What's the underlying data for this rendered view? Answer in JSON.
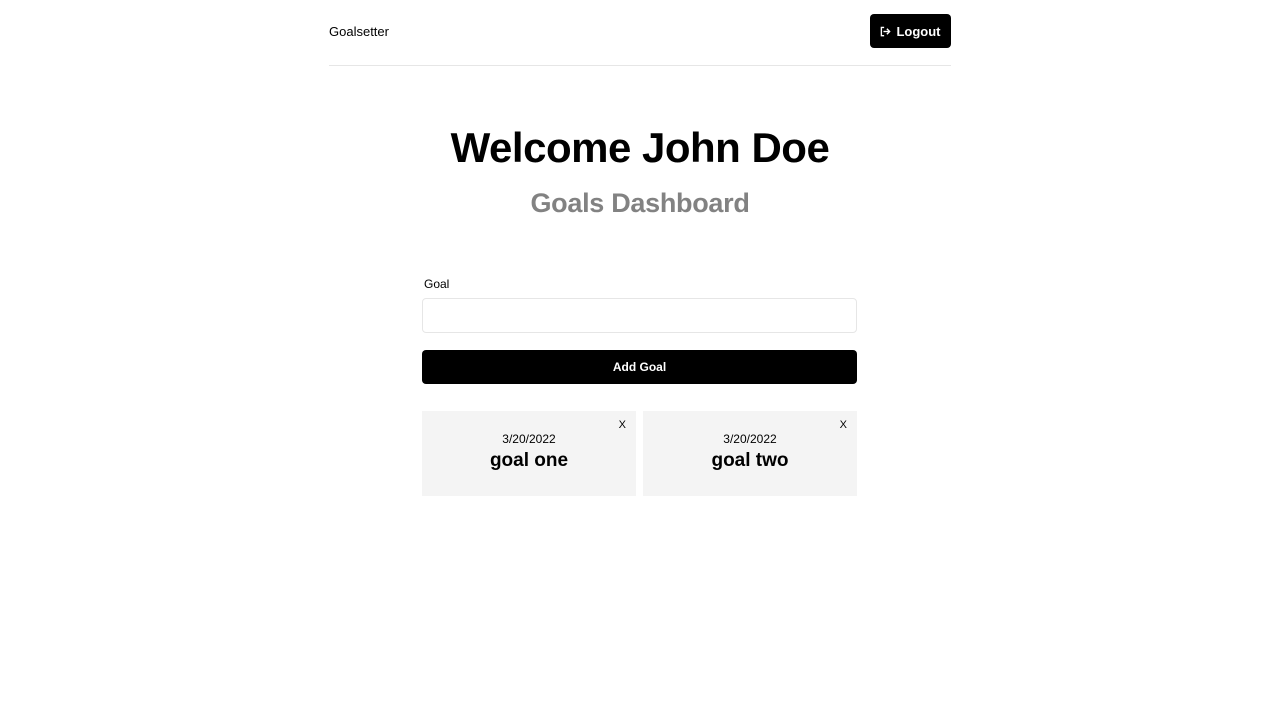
{
  "header": {
    "brand": "Goalsetter",
    "logout_label": "Logout",
    "logout_icon": "sign-out-icon"
  },
  "heading": {
    "welcome": "Welcome John Doe",
    "subtitle": "Goals Dashboard"
  },
  "form": {
    "label": "Goal",
    "input_value": "",
    "input_placeholder": "",
    "submit_label": "Add Goal"
  },
  "goals": [
    {
      "date": "3/20/2022",
      "text": "goal one",
      "delete_label": "X"
    },
    {
      "date": "3/20/2022",
      "text": "goal two",
      "delete_label": "X"
    }
  ],
  "colors": {
    "primary": "#000000",
    "subtitle": "#828282",
    "card_bg": "#f4f4f4",
    "border": "#e6e6e6"
  }
}
